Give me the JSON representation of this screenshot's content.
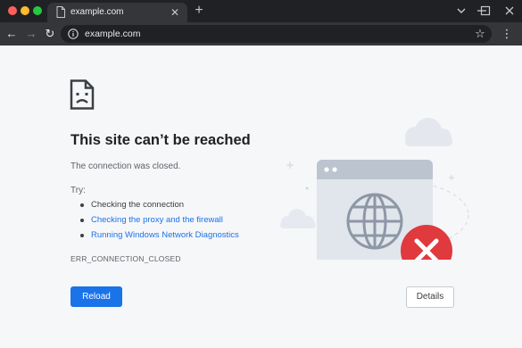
{
  "window": {
    "controls": [
      "close",
      "minimize",
      "zoom"
    ],
    "icons": {
      "tab_chevron": "chevron-down-icon",
      "minimize": "minimize-icon",
      "maximize": "maximize-icon",
      "close": "close-icon"
    }
  },
  "tab": {
    "title": "example.com",
    "favicon": "document-icon",
    "close_glyph": "✕"
  },
  "new_tab_glyph": "+",
  "toolbar": {
    "back_glyph": "←",
    "forward_glyph": "→",
    "reload_glyph": "↻",
    "url": "example.com",
    "info_icon": "info-icon",
    "star_glyph": "☆",
    "menu_glyph": "⋮"
  },
  "error_page": {
    "title": "This site can’t be reached",
    "subtitle": "The connection was closed.",
    "try_label": "Try:",
    "suggestions": [
      {
        "text": "Checking the connection",
        "link": false
      },
      {
        "text": "Checking the proxy and the firewall",
        "link": true
      },
      {
        "text": "Running Windows Network Diagnostics",
        "link": true
      }
    ],
    "error_code": "ERR_CONNECTION_CLOSED",
    "reload_label": "Reload",
    "details_label": "Details"
  },
  "colors": {
    "chrome_dark": "#202124",
    "toolbar": "#35363a",
    "page_background": "#f6f7f9",
    "link": "#1a73e8",
    "primary_button": "#1a73e8",
    "error_badge": "#e0393e"
  }
}
